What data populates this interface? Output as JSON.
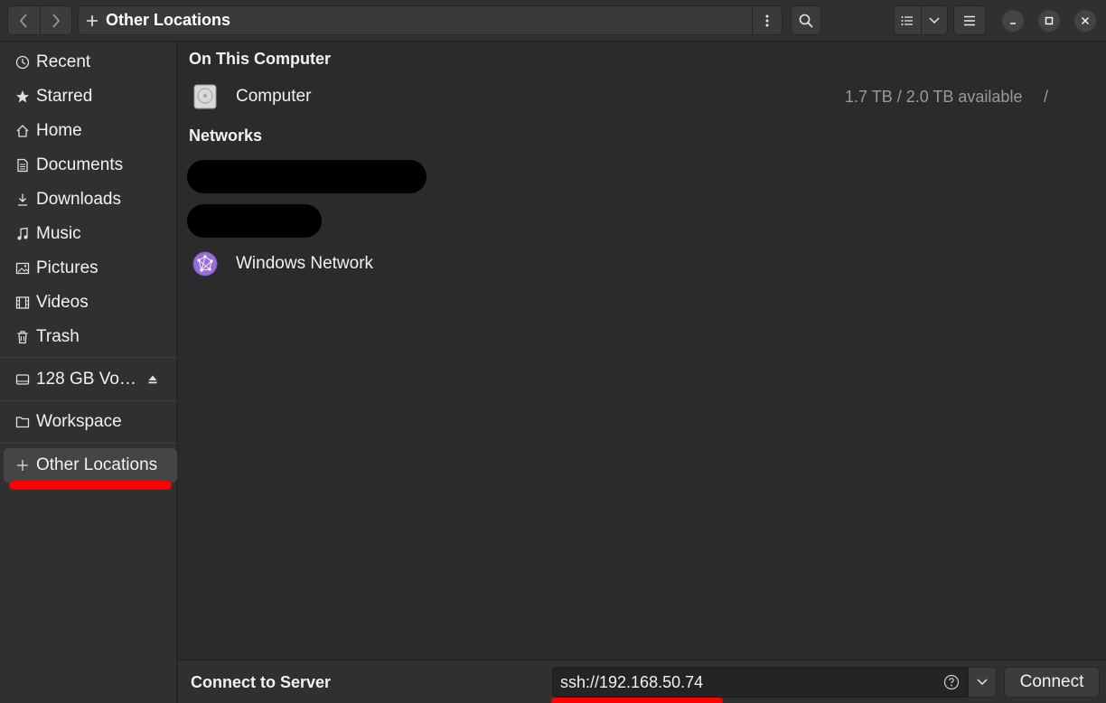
{
  "header": {
    "title": "Other Locations"
  },
  "sidebar": {
    "items": [
      {
        "label": "Recent",
        "icon": "clock-icon"
      },
      {
        "label": "Starred",
        "icon": "star-icon"
      },
      {
        "label": "Home",
        "icon": "home-icon"
      },
      {
        "label": "Documents",
        "icon": "document-icon"
      },
      {
        "label": "Downloads",
        "icon": "download-icon"
      },
      {
        "label": "Music",
        "icon": "music-note-icon"
      },
      {
        "label": "Pictures",
        "icon": "picture-icon"
      },
      {
        "label": "Videos",
        "icon": "film-icon"
      },
      {
        "label": "Trash",
        "icon": "trash-icon"
      }
    ],
    "volume": {
      "label": "128 GB Vo…",
      "icon": "drive-icon"
    },
    "workspace": {
      "label": "Workspace",
      "icon": "folder-icon"
    },
    "other_locations": {
      "label": "Other Locations",
      "icon": "plus-icon"
    }
  },
  "main": {
    "on_this_computer_title": "On This Computer",
    "computer": {
      "label": "Computer",
      "info": "1.7 TB / 2.0 TB available",
      "path": "/"
    },
    "networks_title": "Networks",
    "windows_network": {
      "label": "Windows Network"
    }
  },
  "bottom": {
    "label": "Connect to Server",
    "server_value": "ssh://192.168.50.74",
    "connect_label": "Connect"
  },
  "colors": {
    "accent_red": "#ff0000",
    "window_bg": "#2b2b2b",
    "sidebar_bg": "#303030",
    "network_icon": "#9a6ed8"
  }
}
